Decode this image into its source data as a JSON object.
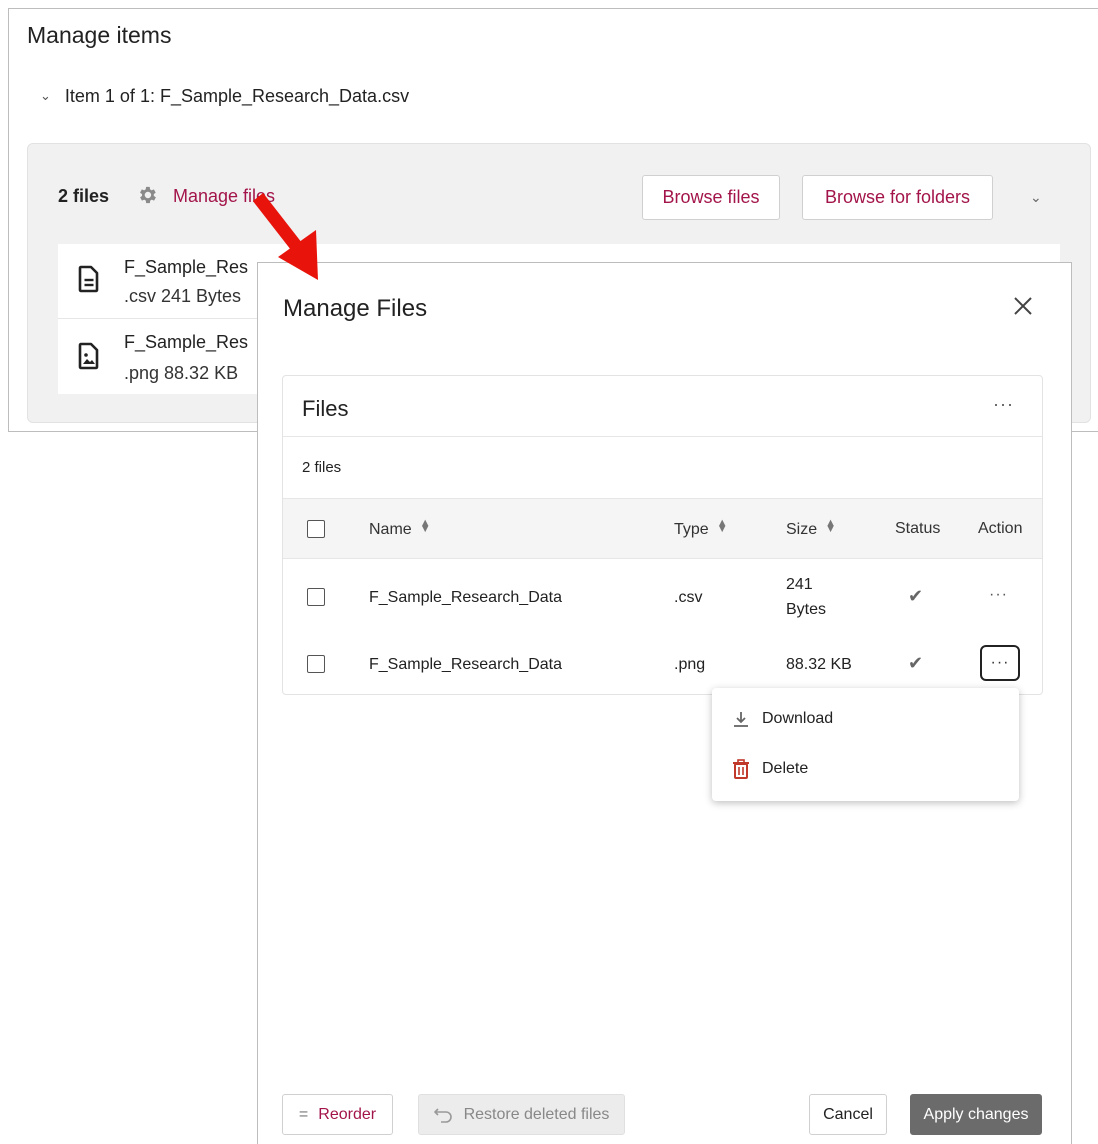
{
  "page": {
    "title": "Manage items",
    "item_header": "Item 1 of 1: F_Sample_Research_Data.csv"
  },
  "files_card": {
    "count_label": "2 files",
    "manage_link": "Manage files",
    "browse_files": "Browse files",
    "browse_folders": "Browse for folders",
    "files": [
      {
        "name": "F_Sample_Res",
        "meta": ".csv  241 Bytes",
        "icon": "document-icon"
      },
      {
        "name": "F_Sample_Res",
        "meta": ".png  88.32 KB",
        "icon": "image-file-icon"
      }
    ]
  },
  "modal": {
    "title": "Manage Files",
    "files_panel": {
      "title": "Files",
      "count": "2 files",
      "columns": {
        "name": "Name",
        "type": "Type",
        "size": "Size",
        "status": "Status",
        "action": "Action"
      },
      "rows": [
        {
          "name": "F_Sample_Research_Data",
          "type": ".csv",
          "size_line1": "241",
          "size_line2": "Bytes",
          "status_icon": "checkmark-icon"
        },
        {
          "name": "F_Sample_Research_Data",
          "type": ".png",
          "size_line1": "88.32 KB",
          "size_line2": "",
          "status_icon": "checkmark-icon"
        }
      ]
    },
    "action_menu": {
      "download": "Download",
      "delete": "Delete"
    },
    "footer": {
      "reorder": "Reorder",
      "restore": "Restore deleted files",
      "cancel": "Cancel",
      "apply": "Apply changes"
    }
  },
  "colors": {
    "accent": "#a3154a",
    "annotation_arrow": "#e8140c",
    "delete_icon": "#c0392b",
    "apply_button": "#6b6b6b"
  }
}
